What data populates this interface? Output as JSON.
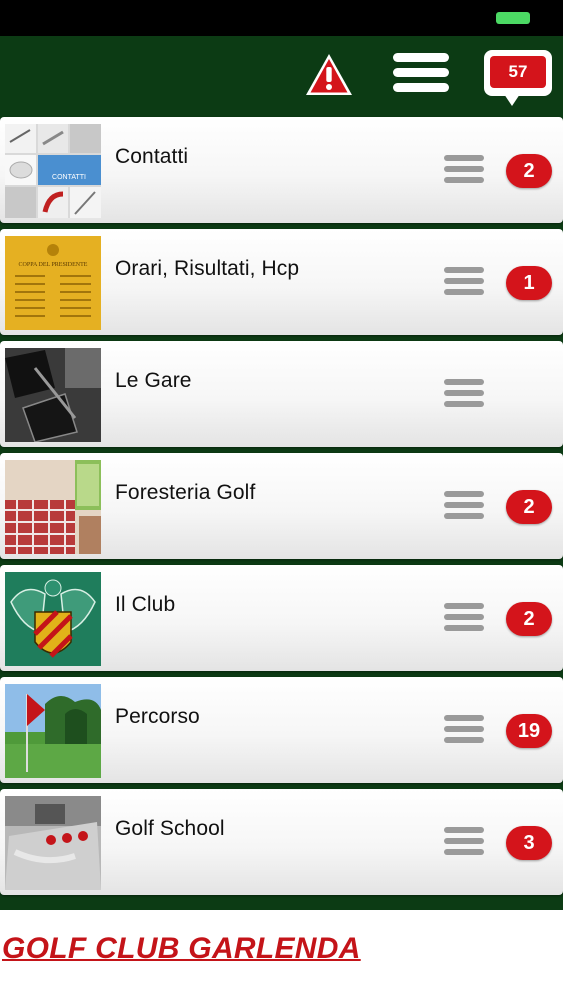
{
  "header": {
    "alert_icon": "warning-triangle-icon",
    "menu_icon": "hamburger-menu-icon",
    "messages_icon": "speech-bubble-icon",
    "messages_count": "57",
    "background_color": "#0c3b14"
  },
  "list": {
    "items": [
      {
        "label": "Contatti",
        "badge": "2",
        "thumb": "contatti"
      },
      {
        "label": "Orari, Risultati, Hcp",
        "badge": "1",
        "thumb": "coppa"
      },
      {
        "label": "Le Gare",
        "badge": "",
        "thumb": "gare"
      },
      {
        "label": "Foresteria Golf",
        "badge": "2",
        "thumb": "foresteria"
      },
      {
        "label": "Il Club",
        "badge": "2",
        "thumb": "club"
      },
      {
        "label": "Percorso",
        "badge": "19",
        "thumb": "percorso"
      },
      {
        "label": "Golf School",
        "badge": "3",
        "thumb": "school"
      }
    ]
  },
  "thumbnails": {
    "contatti_caption": "CONTATTI",
    "coppa_caption": "COPPA DEL PRESIDENTE"
  },
  "footer": {
    "title": "GOLF CLUB GARLENDA"
  },
  "colors": {
    "header_bg": "#0c3b14",
    "badge_red": "#d4141b",
    "footer_text": "#c41419"
  }
}
